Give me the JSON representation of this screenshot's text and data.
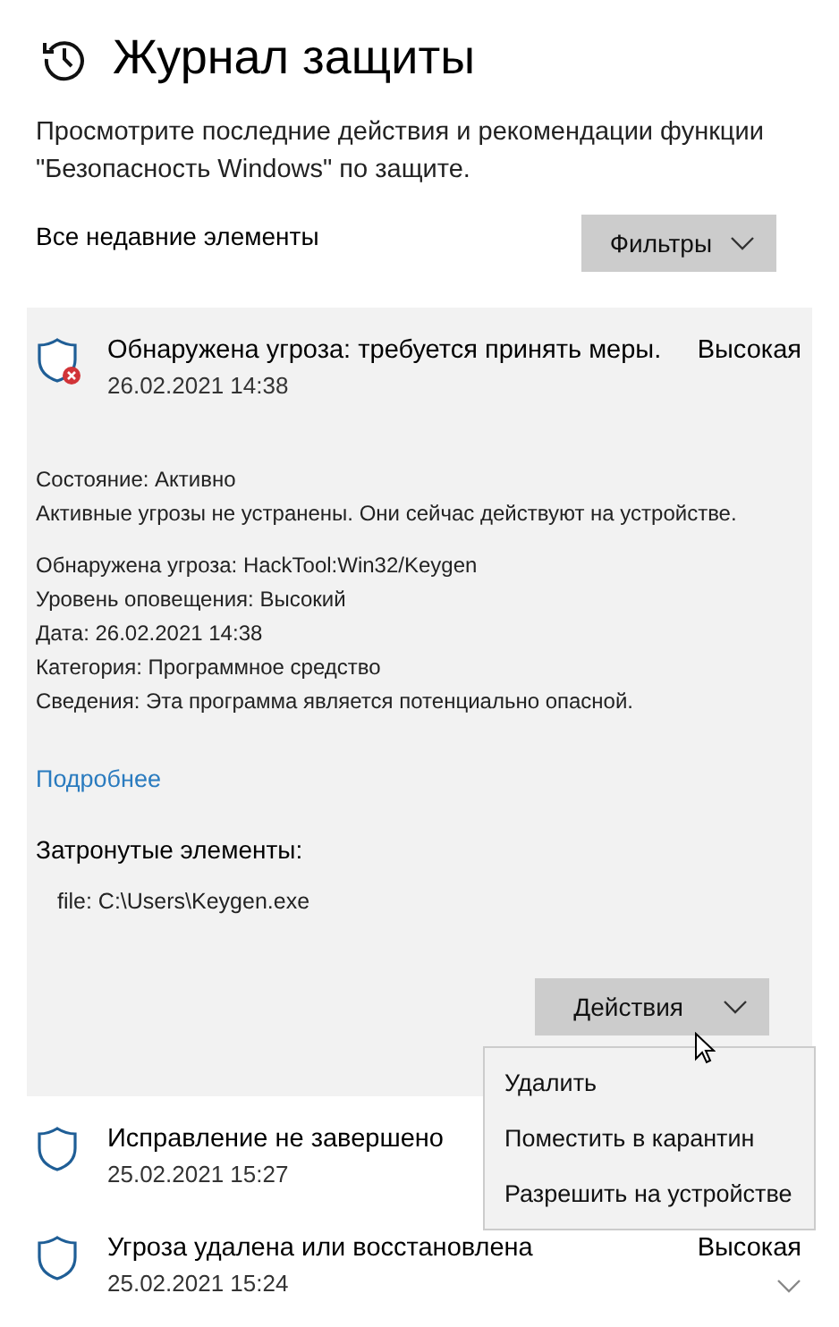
{
  "header": {
    "title": "Журнал защиты",
    "description": "Просмотрите последние действия и рекомендации функции \"Безопасность Windows\" по защите."
  },
  "filter_bar": {
    "label": "Все недавние элементы",
    "button": "Фильтры"
  },
  "events": [
    {
      "title": "Обнаружена угроза: требуется принять меры.",
      "severity": "Высокая",
      "date": "26.02.2021 14:38",
      "expanded": true,
      "alert": true,
      "status_lines": [
        "Состояние:  Активно",
        "Активные угрозы не устранены. Они сейчас действуют на устройстве."
      ],
      "detail_lines": [
        "Обнаружена угроза:  HackTool:Win32/Keygen",
        "Уровень оповещения:  Высокий",
        "Дата:  26.02.2021 14:38",
        "Категория:  Программное средство",
        "Сведения:  Эта программа является потенциально опасной."
      ],
      "link": "Подробнее",
      "affected_heading": "Затронутые элементы:",
      "affected_items": [
        "file: C:\\Users\\Keygen.exe"
      ],
      "actions_button": "Действия",
      "actions_menu": {
        "open": true,
        "items": [
          "Удалить",
          "Поместить в карантин",
          "Разрешить на устройстве"
        ]
      }
    },
    {
      "title": "Исправление не завершено",
      "date": "25.02.2021 15:27",
      "expanded": false,
      "alert": false
    },
    {
      "title": "Угроза удалена или восстановлена",
      "severity": "Высокая",
      "date": "25.02.2021 15:24",
      "expanded": false,
      "alert": false
    }
  ]
}
